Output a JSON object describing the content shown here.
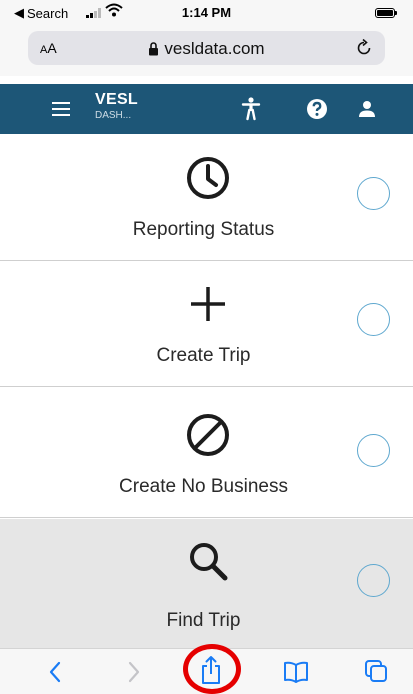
{
  "status_bar": {
    "back_label": "Search",
    "time": "1:14 PM"
  },
  "browser": {
    "aa_large": "A",
    "aa_small": "A",
    "url": "vesldata.com"
  },
  "header": {
    "title": "VESL",
    "subtitle": "DASH...",
    "bg_color": "#1d5677"
  },
  "cards": [
    {
      "label": "Reporting Status",
      "icon": "clock-icon"
    },
    {
      "label": "Create Trip",
      "icon": "plus-icon"
    },
    {
      "label": "Create No Business",
      "icon": "prohibited-icon"
    },
    {
      "label": "Find Trip",
      "icon": "search-icon"
    }
  ],
  "colors": {
    "radio_outline": "#5fa8cf",
    "toolbar_accent": "#1a7cf5",
    "highlight": "#e50000"
  }
}
